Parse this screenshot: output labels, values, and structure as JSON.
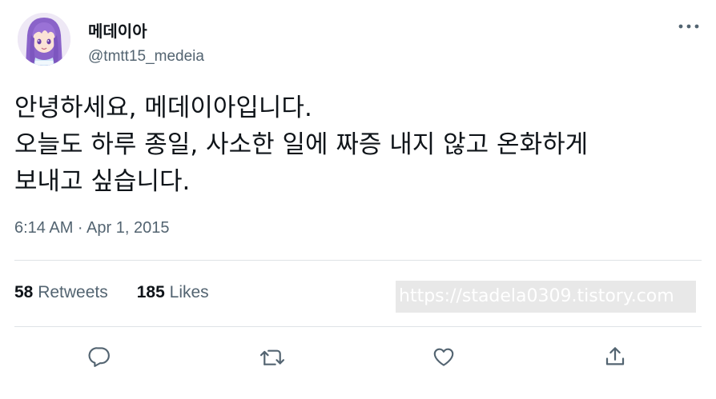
{
  "author": {
    "name": "메데이아",
    "handle": "@tmtt15_medeia",
    "avatar": "anime-girl-avatar"
  },
  "tweet": {
    "lines": [
      "안녕하세요, 메데이아입니다.",
      "오늘도 하루 종일, 사소한 일에 짜증 내지 않고 온화하게",
      "보내고 싶습니다."
    ],
    "timestamp": "6:14 AM · Apr 1, 2015"
  },
  "stats": {
    "retweets_count": "58",
    "retweets_label": "Retweets",
    "likes_count": "185",
    "likes_label": "Likes"
  },
  "watermark": "https://stadela0309.tistory.com",
  "actions": [
    {
      "icon": "reply-icon"
    },
    {
      "icon": "retweet-icon"
    },
    {
      "icon": "like-icon"
    },
    {
      "icon": "share-icon"
    }
  ],
  "colors": {
    "text": "#0f1419",
    "secondary": "#536471",
    "divider": "#dfe3e6"
  }
}
